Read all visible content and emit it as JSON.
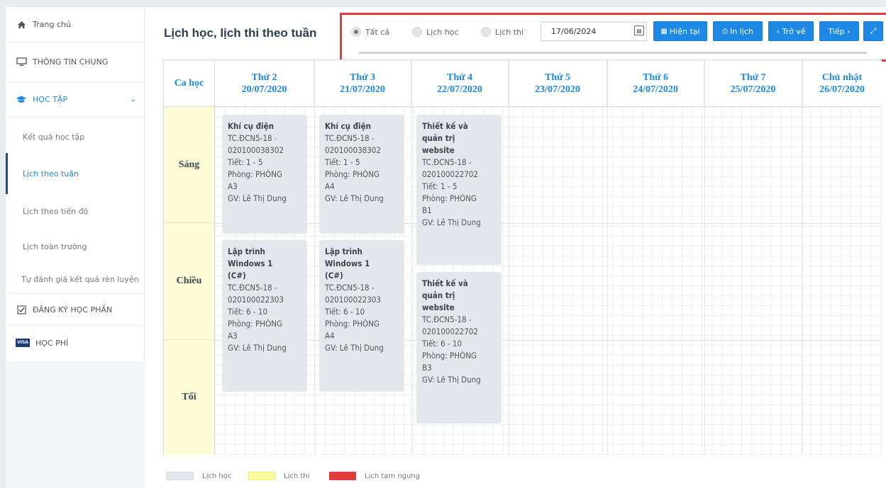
{
  "sidebar": {
    "home": "Trang chủ",
    "general_info": "THÔNG TIN CHUNG",
    "study": "HỌC TẬP",
    "sub_items": [
      "Kết quả học tập",
      "Lịch theo tuần",
      "Lịch theo tiến độ",
      "Lịch toàn trường",
      "Tự đánh giá kết quả rèn luyện"
    ],
    "course_registration": "ĐĂNG KÝ HỌC PHẦN",
    "tuition": "HỌC PHÍ",
    "tuition_badge": "VISA"
  },
  "page_title": "Lịch học, lịch thi theo tuần",
  "toolbar": {
    "filter_all": "Tất cả",
    "filter_study": "Lịch học",
    "filter_exam": "Lịch thi",
    "selected_filter": "Tất cả",
    "date_value": "17/06/2024",
    "current_button": "Hiện tại",
    "print_button": "In lịch",
    "back_button": "‹ Trở về",
    "next_button": "Tiếp ›"
  },
  "schedule": {
    "shift_header": "Ca học",
    "days": [
      {
        "name": "Thứ 2",
        "date": "20/07/2020"
      },
      {
        "name": "Thứ 3",
        "date": "21/07/2020"
      },
      {
        "name": "Thứ 4",
        "date": "22/07/2020"
      },
      {
        "name": "Thứ 5",
        "date": "23/07/2020"
      },
      {
        "name": "Thứ 6",
        "date": "24/07/2020"
      },
      {
        "name": "Thứ 7",
        "date": "25/07/2020"
      },
      {
        "name": "Chủ nhật",
        "date": "26/07/2020"
      }
    ],
    "shifts": [
      "Sáng",
      "Chiều",
      "Tối"
    ],
    "cards": [
      {
        "title": "Khí cụ điện",
        "lines": [
          "TC.ĐCN5-18 -",
          "020100038302",
          "Tiết: 1 - 5",
          "Phòng: PHÒNG",
          "A3",
          "GV: Lê Thị Dung"
        ]
      },
      {
        "title": "Khí cụ điện",
        "lines": [
          "TC.ĐCN5-18 -",
          "020100038302",
          "Tiết: 1 - 5",
          "Phòng: PHÒNG",
          "A4",
          "GV: Lê Thị Dung"
        ]
      },
      {
        "title": "Thiết kế và quản trị website",
        "lines": [
          "TC.ĐCN5-18 -",
          "020100022702",
          "Tiết: 1 - 5",
          "Phòng: PHÒNG",
          "B1",
          "GV: Lê Thị Dung"
        ]
      },
      {
        "title": "Lập trình Windows 1 (C#)",
        "lines": [
          "TC.ĐCN5-18 -",
          "020100022303",
          "Tiết: 6 - 10",
          "Phòng: PHÒNG",
          "A3",
          "GV: Lê Thị Dung"
        ]
      },
      {
        "title": "Lập trình Windows 1 (C#)",
        "lines": [
          "TC.ĐCN5-18 -",
          "020100022303",
          "Tiết: 6 - 10",
          "Phòng: PHÒNG",
          "A4",
          "GV: Lê Thị Dung"
        ]
      },
      {
        "title": "Thiết kế và quản trị website",
        "lines": [
          "TC.ĐCN5-18 -",
          "020100022702",
          "Tiết: 6 - 10",
          "Phòng: PHÒNG",
          "B3",
          "GV: Lê Thị Dung"
        ]
      }
    ]
  },
  "legend": {
    "study": "Lịch học",
    "exam": "Lịch thi",
    "suspended": "Lịch tạm ngưng",
    "colors": {
      "study": "#e4e7eb",
      "exam": "#fffa9c",
      "suspended": "#e03c3c"
    }
  },
  "colors": {
    "accent": "#1e88e5",
    "highlight_border": "#e03c3c"
  }
}
